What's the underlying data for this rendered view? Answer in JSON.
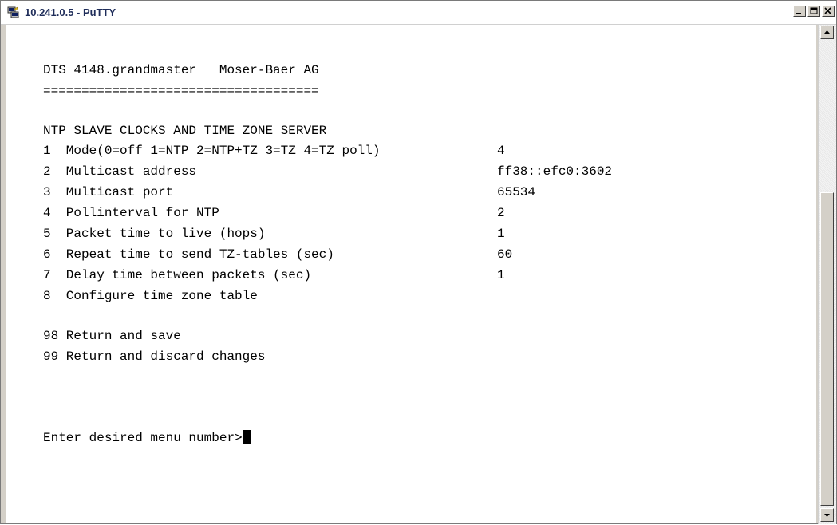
{
  "window": {
    "title": "10.241.0.5 - PuTTY"
  },
  "terminal": {
    "header": "DTS 4148.grandmaster   Moser-Baer AG",
    "divider": "====================================",
    "section_title": "NTP SLAVE CLOCKS AND TIME ZONE SERVER",
    "menu_items": [
      {
        "label": "1  Mode(0=off 1=NTP 2=NTP+TZ 3=TZ 4=TZ poll)",
        "value": "4"
      },
      {
        "label": "2  Multicast address",
        "value": "ff38::efc0:3602"
      },
      {
        "label": "3  Multicast port",
        "value": "65534"
      },
      {
        "label": "4  Pollinterval for NTP",
        "value": "2"
      },
      {
        "label": "5  Packet time to live (hops)",
        "value": "1"
      },
      {
        "label": "6  Repeat time to send TZ-tables (sec)",
        "value": "60"
      },
      {
        "label": "7  Delay time between packets (sec)",
        "value": "1"
      },
      {
        "label": "8  Configure time zone table",
        "value": ""
      }
    ],
    "actions": [
      "98 Return and save",
      "99 Return and discard changes"
    ],
    "prompt": "Enter desired menu number>"
  },
  "icons": {
    "app": "putty-icon",
    "minimize": "minimize-icon",
    "maximize": "maximize-icon",
    "close": "close-icon",
    "scroll_up": "scroll-up-arrow-icon",
    "scroll_down": "scroll-down-arrow-icon"
  }
}
